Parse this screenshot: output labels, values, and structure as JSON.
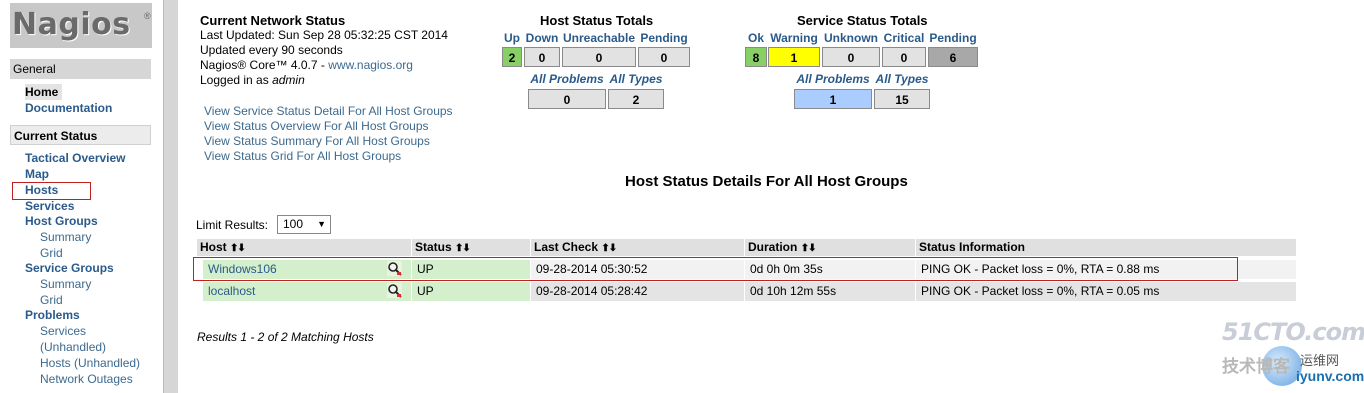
{
  "logo": {
    "text": "Nagios",
    "reg": "®"
  },
  "sidebar": {
    "general_heading": "General",
    "home": "Home",
    "documentation": "Documentation",
    "current_status_heading": "Current Status",
    "tactical_overview": "Tactical Overview",
    "map": "Map",
    "hosts": "Hosts",
    "services": "Services",
    "host_groups": "Host Groups",
    "hg_summary": "Summary",
    "hg_grid": "Grid",
    "service_groups": "Service Groups",
    "sg_summary": "Summary",
    "sg_grid": "Grid",
    "problems": "Problems",
    "p_services": "Services",
    "p_unhandled": "(Unhandled)",
    "p_hosts": "Hosts (Unhandled)",
    "p_outages": "Network Outages"
  },
  "status_info": {
    "title": "Current Network Status",
    "last_updated": "Last Updated: Sun Sep 28 05:32:25 CST 2014",
    "updated_every": "Updated every 90 seconds",
    "core_prefix": "Nagios® Core™ 4.0.7 - ",
    "core_link": "www.nagios.org",
    "logged_in_prefix": "Logged in as ",
    "user": "admin"
  },
  "view_links": [
    "View Service Status Detail For All Host Groups",
    "View Status Overview For All Host Groups",
    "View Status Summary For All Host Groups",
    "View Status Grid For All Host Groups"
  ],
  "host_totals": {
    "title": "Host Status Totals",
    "headers": [
      "Up",
      "Down",
      "Unreachable",
      "Pending"
    ],
    "values": [
      "2",
      "0",
      "0",
      "0"
    ],
    "sub_headers": [
      "All Problems",
      "All Types"
    ],
    "sub_values": [
      "0",
      "2"
    ]
  },
  "service_totals": {
    "title": "Service Status Totals",
    "headers": [
      "Ok",
      "Warning",
      "Unknown",
      "Critical",
      "Pending"
    ],
    "values": [
      "8",
      "1",
      "0",
      "0",
      "6"
    ],
    "sub_headers": [
      "All Problems",
      "All Types"
    ],
    "sub_values": [
      "1",
      "15"
    ]
  },
  "details_title": "Host Status Details For All Host Groups",
  "limit": {
    "label": "Limit Results:",
    "value": "100"
  },
  "table": {
    "headers": [
      "Host",
      "Status",
      "Last Check",
      "Duration",
      "Status Information"
    ],
    "rows": [
      {
        "host": "Windows106",
        "status": "UP",
        "last_check": "09-28-2014 05:30:52",
        "duration": "0d 0h 0m 35s",
        "info": "PING OK - Packet loss = 0%, RTA = 0.88 ms"
      },
      {
        "host": "localhost",
        "status": "UP",
        "last_check": "09-28-2014 05:28:42",
        "duration": "0d 10h 12m 55s",
        "info": "PING OK - Packet loss = 0%, RTA = 0.05 ms"
      }
    ]
  },
  "results_text": "Results 1 - 2 of 2 Matching Hosts",
  "watermark": {
    "line1": "51CTO.com",
    "line2": "技术博客",
    "line3": "运维网",
    "line4": "iyunv.com"
  },
  "colors": {
    "up": "#88d066",
    "warning": "#ffff00",
    "pending": "#a8a8a8",
    "problems": "#aaccff",
    "link": "#2a5a8a",
    "highlight": "#c02020"
  }
}
